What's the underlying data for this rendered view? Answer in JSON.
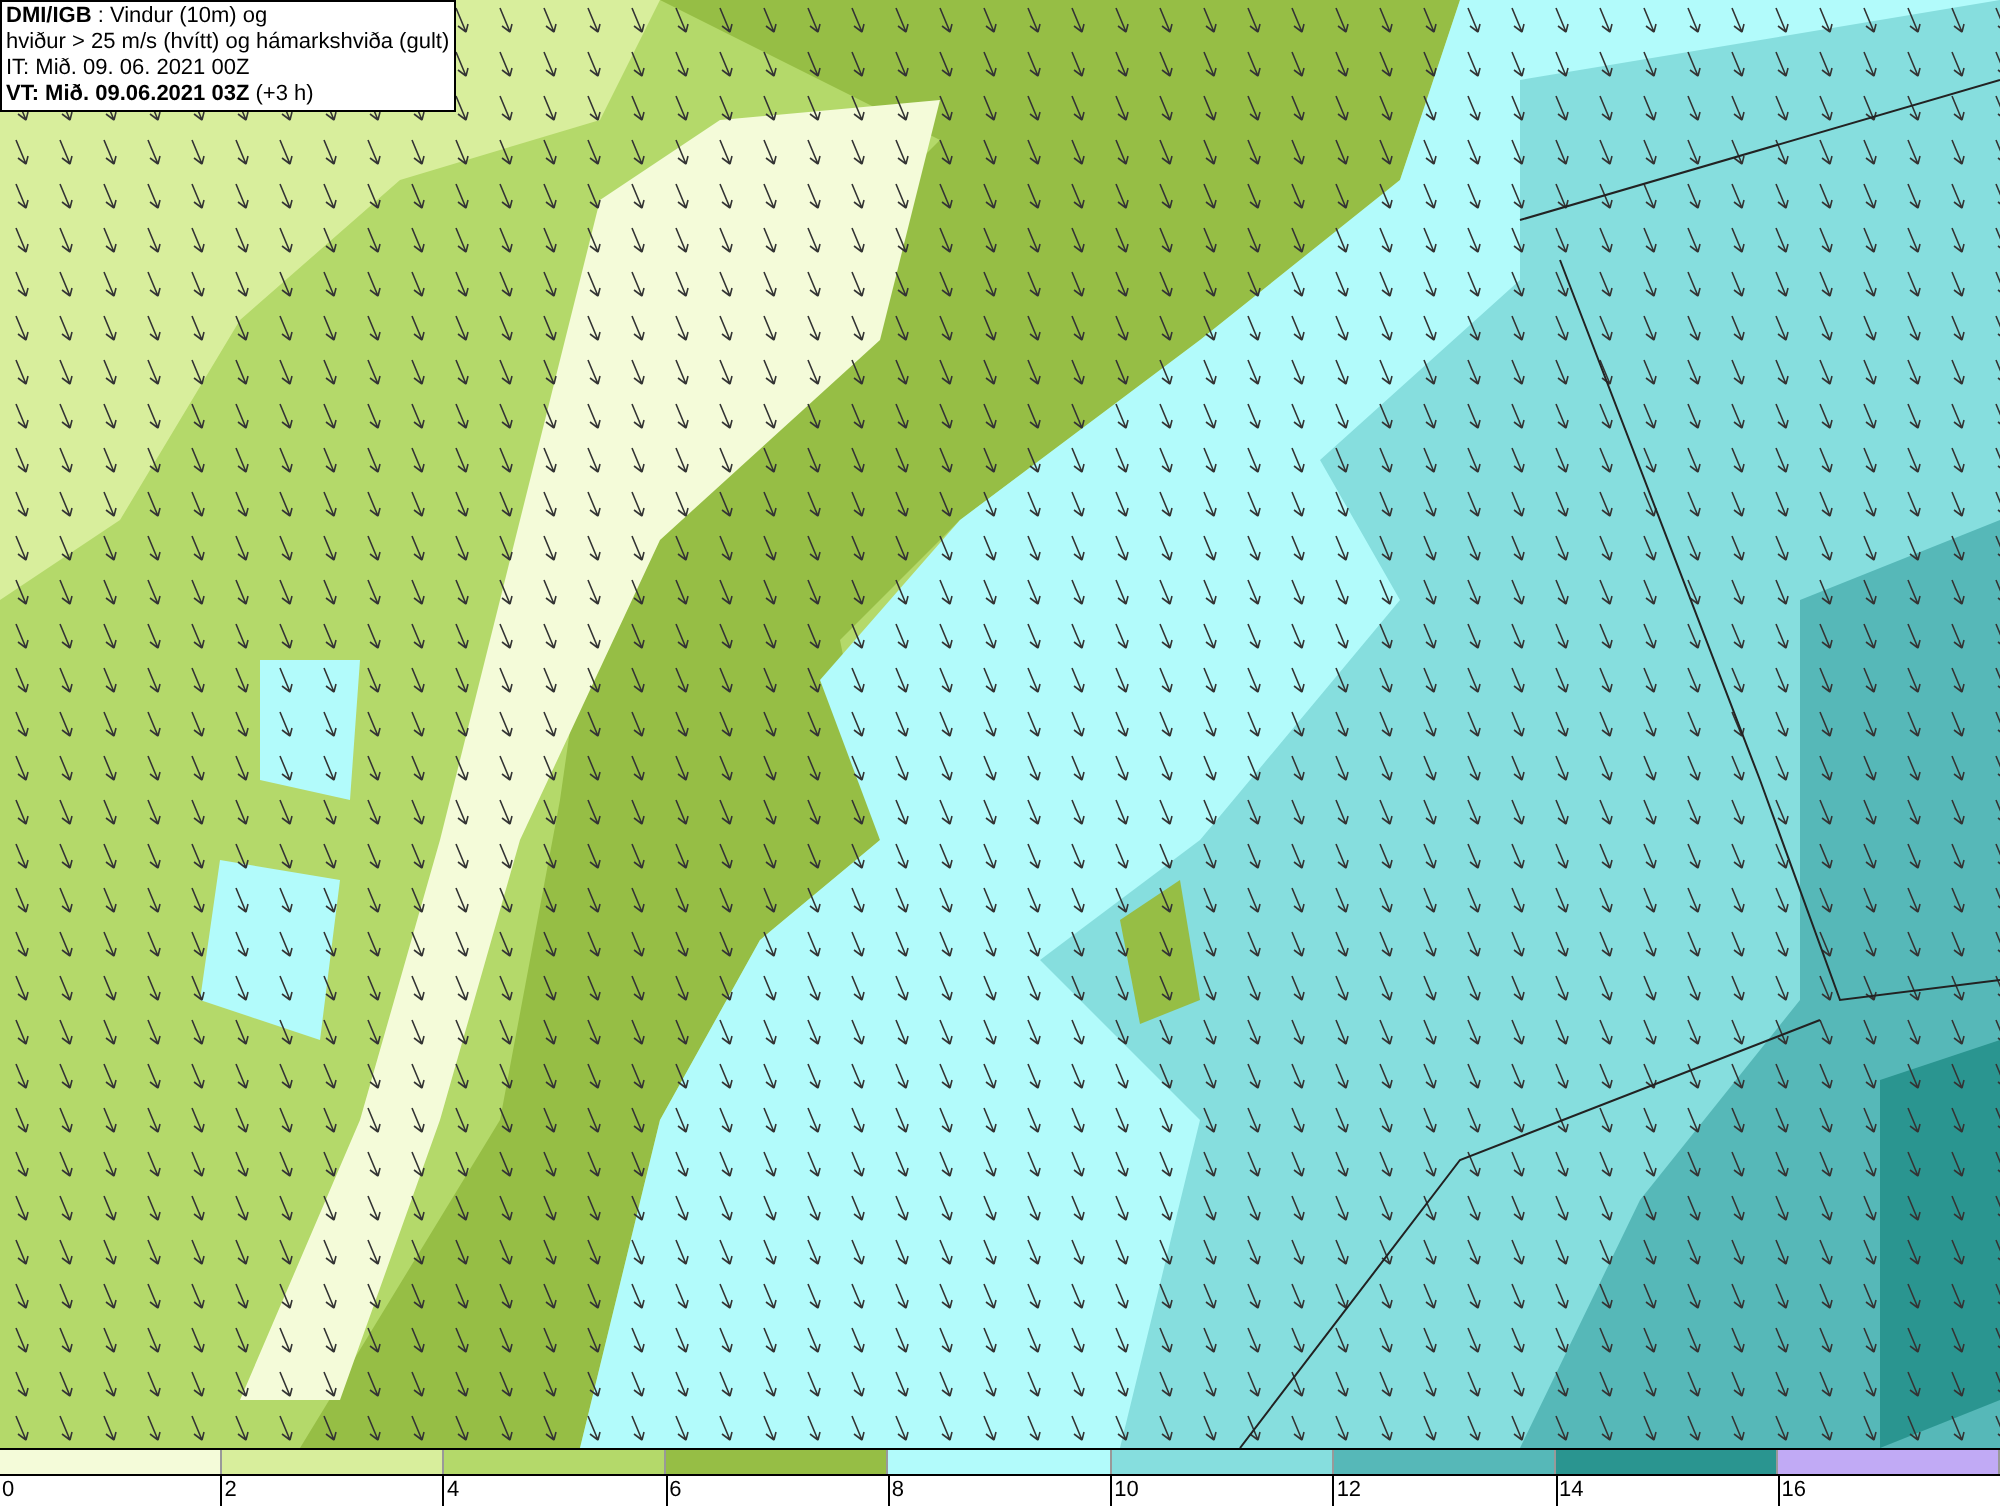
{
  "title_box": {
    "lines": [
      "**DMI/IGB** : Vindur (10m) og",
      "hviður > 25 m/s (hvítt) og hámarkshviða (gult)",
      "IT: Mið. 09. 06. 2021 00Z",
      "**VT: Mið. 09.06.2021 03Z** (+3 h)"
    ]
  },
  "legend": {
    "bins": [
      {
        "label": "0",
        "color": "#f4fbd9"
      },
      {
        "label": "2",
        "color": "#d8ee9c"
      },
      {
        "label": "4",
        "color": "#b4d96a"
      },
      {
        "label": "6",
        "color": "#96be45"
      },
      {
        "label": "8",
        "color": "#b2fbfb"
      },
      {
        "label": "10",
        "color": "#86dede"
      },
      {
        "label": "12",
        "color": "#56b8b8"
      },
      {
        "label": "14",
        "color": "#2a9590"
      },
      {
        "label": "16",
        "color": "#c1aaf5"
      }
    ]
  }
}
